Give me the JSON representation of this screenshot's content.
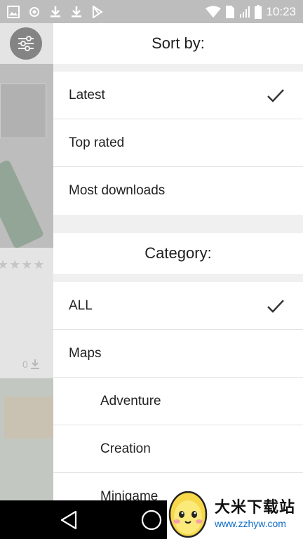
{
  "status_bar": {
    "time": "10:23",
    "left_icons": [
      "image-icon",
      "sync-icon",
      "download-icon",
      "download-icon",
      "play-store-icon"
    ],
    "right_icons": [
      "wifi-icon",
      "sim-icon",
      "signal-icon",
      "battery-icon"
    ]
  },
  "background_app": {
    "filter_icon": "sliders-icon",
    "download_count": "0"
  },
  "sort": {
    "title": "Sort by:",
    "options": [
      {
        "label": "Latest",
        "checked": true
      },
      {
        "label": "Top rated",
        "checked": false
      },
      {
        "label": "Most downloads",
        "checked": false
      }
    ]
  },
  "category": {
    "title": "Category:",
    "options": [
      {
        "label": "ALL",
        "checked": true
      },
      {
        "label": "Maps",
        "checked": false
      },
      {
        "label": "Adventure",
        "checked": false
      },
      {
        "label": "Creation",
        "checked": false
      },
      {
        "label": "Minigame",
        "checked": false
      }
    ]
  },
  "watermark": {
    "title": "大米下载站",
    "url": "www.zzhyw.com"
  },
  "colors": {
    "status_bar": "#bdbdbd",
    "section_gap": "#f0f0f0",
    "divider": "#e2e2e2",
    "check": "#333333",
    "url": "#0d6cc7"
  }
}
